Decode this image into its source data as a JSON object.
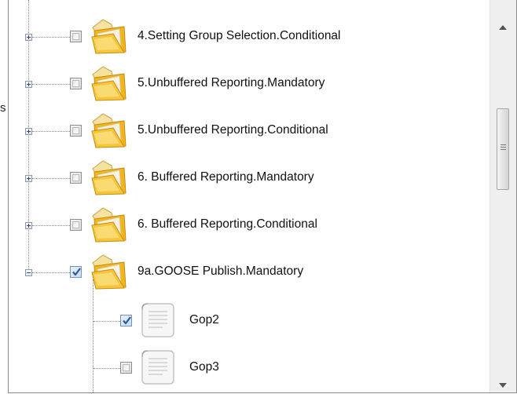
{
  "side_mark": "s",
  "tree": {
    "nodes": [
      {
        "label": "4.Setting Group Selection.Conditional",
        "type": "folder",
        "expander": "plus",
        "checked": false
      },
      {
        "label": "5.Unbuffered Reporting.Mandatory",
        "type": "folder",
        "expander": "plus",
        "checked": false
      },
      {
        "label": "5.Unbuffered Reporting.Conditional",
        "type": "folder",
        "expander": "plus",
        "checked": false
      },
      {
        "label": "6. Buffered Reporting.Mandatory",
        "type": "folder",
        "expander": "plus",
        "checked": false
      },
      {
        "label": "6. Buffered Reporting.Conditional",
        "type": "folder",
        "expander": "plus",
        "checked": false
      },
      {
        "label": "9a.GOOSE Publish.Mandatory",
        "type": "folder",
        "expander": "minus",
        "checked": true
      },
      {
        "label": "Gop2",
        "type": "document",
        "expander": "none",
        "checked": true
      },
      {
        "label": "Gop3",
        "type": "document",
        "expander": "none",
        "checked": false
      }
    ]
  },
  "scrollbar": {
    "up_icon": "arrow-up-icon",
    "down_icon": "arrow-down-icon",
    "grip_icon": "grip-icon"
  },
  "colors": {
    "folder_body": "#f2b51c",
    "folder_light": "#fbe48a",
    "checkmark": "#2c5aa0"
  }
}
